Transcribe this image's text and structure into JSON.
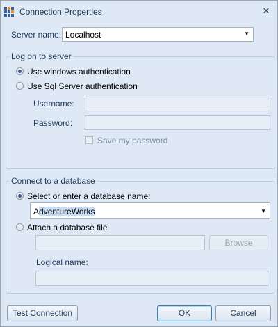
{
  "window": {
    "title": "Connection Properties"
  },
  "server": {
    "label": "Server name:",
    "value": "Localhost"
  },
  "logon": {
    "group_title": "Log on to server",
    "windows_auth_label": "Use windows authentication",
    "sql_auth_label": "Use Sql Server authentication",
    "selected": "windows",
    "username_label": "Username:",
    "password_label": "Password:",
    "save_password_label": "Save my password"
  },
  "database": {
    "group_title": "Connect to a database",
    "select_label": "Select or enter a database name:",
    "db_name_first": "A",
    "db_name_rest": "dventureWorks",
    "attach_label": "Attach a database file",
    "browse_label": "Browse",
    "logical_name_label": "Logical name:"
  },
  "buttons": {
    "test": "Test Connection",
    "ok": "OK",
    "cancel": "Cancel"
  },
  "colors": {
    "background": "#dfe9f5",
    "accent": "#3b5d8d"
  }
}
